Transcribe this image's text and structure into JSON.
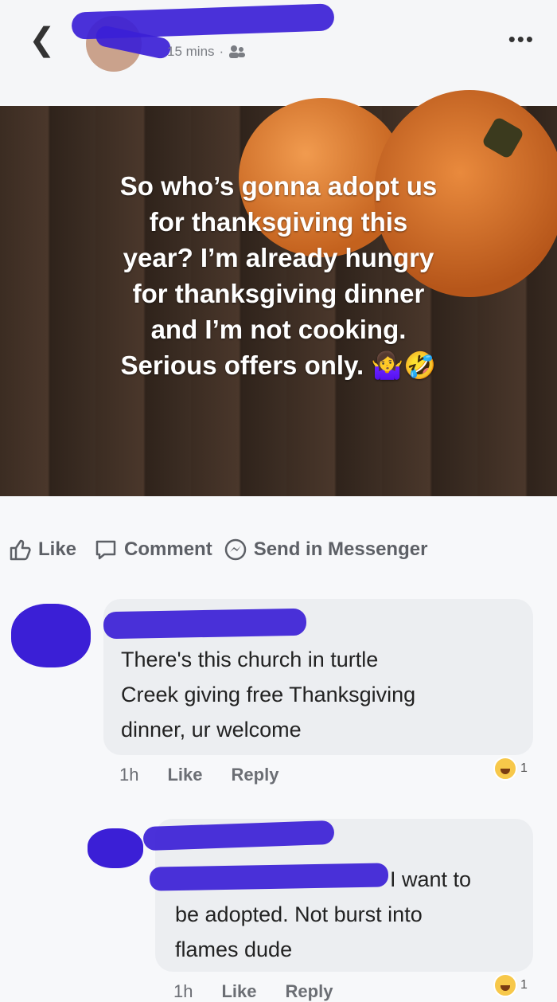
{
  "header": {
    "back_icon": "chevron-left-icon",
    "time": "15 mins",
    "separator": "·",
    "privacy_icon": "friends-icon",
    "more_icon": "more-dots-icon"
  },
  "post": {
    "text_lines": [
      "So who’s gonna adopt us",
      "for thanksgiving this",
      "year? I’m already hungry",
      "for thanksgiving dinner",
      "and I’m not cooking.",
      "Serious offers only. 🤷‍♀️🤣"
    ]
  },
  "actions": {
    "like": "Like",
    "comment": "Comment",
    "send": "Send in Messenger"
  },
  "comments": [
    {
      "lines": [
        "There's this church in turtle",
        "Creek giving free Thanksgiving",
        "dinner, ur welcome"
      ],
      "time": "1h",
      "like": "Like",
      "reply": "Reply",
      "reaction_count": "1"
    },
    {
      "line1_visible": "I want to",
      "lines": [
        "be adopted. Not burst into",
        "flames dude"
      ],
      "time": "1h",
      "like": "Like",
      "reply": "Reply",
      "reaction_count": "1"
    }
  ]
}
